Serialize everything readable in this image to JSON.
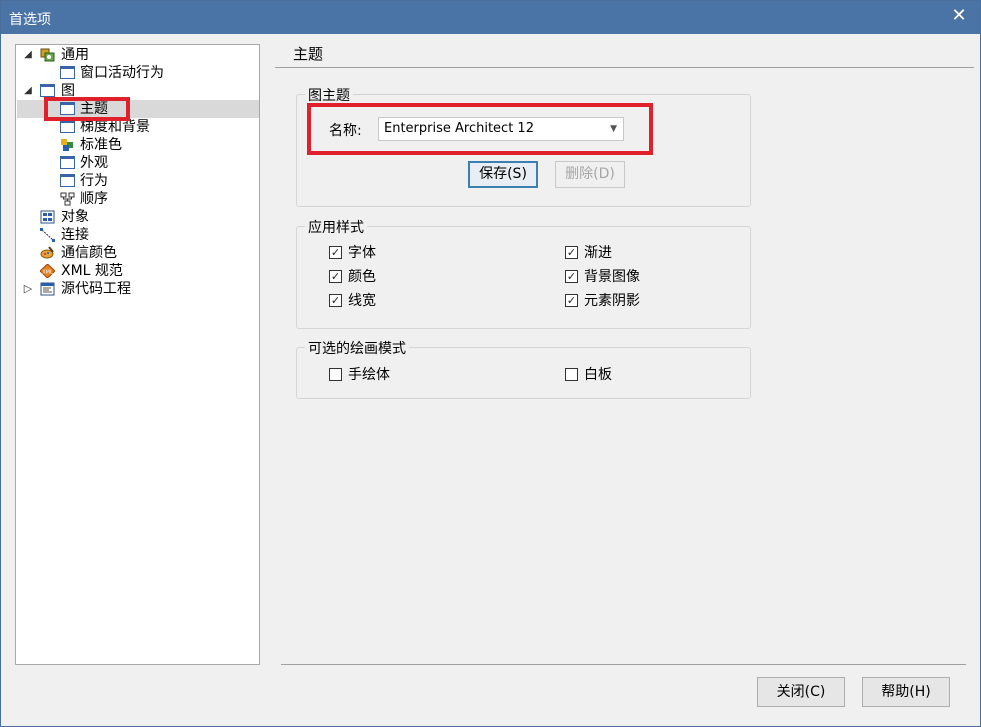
{
  "window": {
    "title": "首选项"
  },
  "tree": {
    "items": [
      {
        "label": "通用",
        "expander": "◢",
        "icon": "settings-icon"
      },
      {
        "label": "窗口活动行为",
        "icon": "window-icon"
      },
      {
        "label": "图",
        "expander": "◢",
        "icon": "window-icon"
      },
      {
        "label": "主题",
        "icon": "window-icon",
        "selected": true
      },
      {
        "label": "梯度和背景",
        "icon": "window-icon"
      },
      {
        "label": "标准色",
        "icon": "palette-icon"
      },
      {
        "label": "外观",
        "icon": "window-icon"
      },
      {
        "label": "行为",
        "icon": "window-icon"
      },
      {
        "label": "顺序",
        "icon": "hierarchy-icon"
      },
      {
        "label": "对象",
        "icon": "objects-icon"
      },
      {
        "label": "连接",
        "icon": "connector-icon"
      },
      {
        "label": "通信颜色",
        "icon": "paint-icon"
      },
      {
        "label": "XML 规范",
        "icon": "xml-icon"
      },
      {
        "label": "源代码工程",
        "expander": "▷",
        "icon": "code-icon"
      }
    ]
  },
  "pane": {
    "title": "主题",
    "theme_group": {
      "legend": "图主题",
      "name_label": "名称:",
      "name_value": "Enterprise Architect 12",
      "save_label": "保存(S)",
      "delete_label": "删除(D)"
    },
    "apply_group": {
      "legend": "应用样式",
      "options": [
        {
          "label": "字体",
          "checked": true
        },
        {
          "label": "渐进",
          "checked": true
        },
        {
          "label": "颜色",
          "checked": true
        },
        {
          "label": "背景图像",
          "checked": true
        },
        {
          "label": "线宽",
          "checked": true
        },
        {
          "label": "元素阴影",
          "checked": true
        }
      ]
    },
    "draw_group": {
      "legend": "可选的绘画模式",
      "options": [
        {
          "label": "手绘体",
          "checked": false
        },
        {
          "label": "白板",
          "checked": false
        }
      ]
    }
  },
  "footer": {
    "close_label": "关闭(C)",
    "help_label": "帮助(H)"
  },
  "colors": {
    "titlebar": "#4a74a6",
    "highlight": "#e0202a",
    "selection": "#d9d9d9"
  }
}
